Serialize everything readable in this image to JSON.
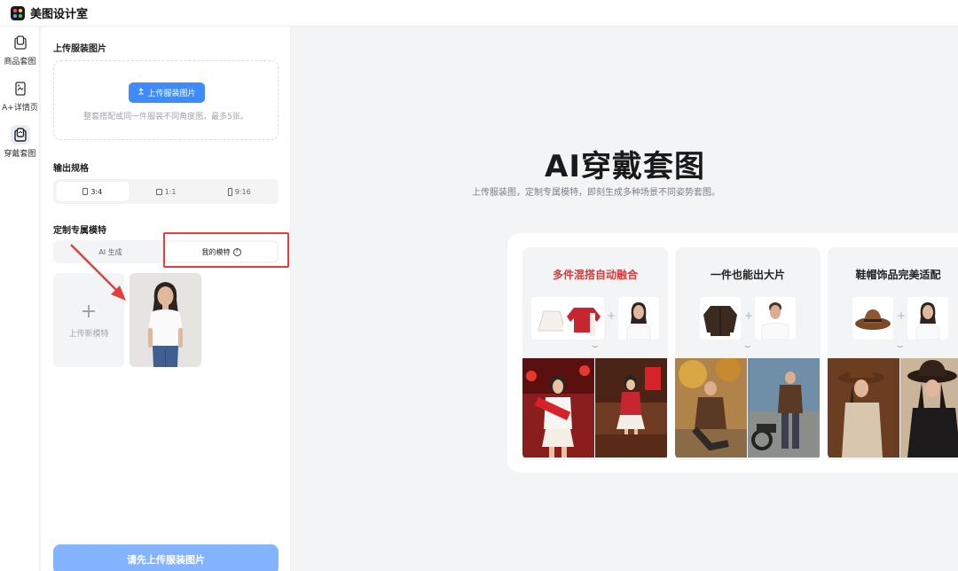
{
  "app": {
    "title": "美图设计室"
  },
  "rail": {
    "items": [
      {
        "label": "商品套图",
        "icon": "product-set-icon"
      },
      {
        "label": "A+详情页",
        "icon": "detail-page-icon"
      },
      {
        "label": "穿戴套图",
        "icon": "wear-set-icon",
        "active": true
      }
    ]
  },
  "panel": {
    "upload_title": "上传服装图片",
    "upload_button": "上传服装图片",
    "upload_hint": "整套搭配或同一件服装不同角度图，最多5张。",
    "output_title": "输出规格",
    "ratios": [
      {
        "label": "3:4",
        "active": true
      },
      {
        "label": "1:1",
        "active": false
      },
      {
        "label": "9:16",
        "active": false
      }
    ],
    "model_title": "定制专属模特",
    "model_tabs": [
      {
        "label": "AI 生成",
        "active": false
      },
      {
        "label": "我的模特",
        "active": true
      }
    ],
    "add_model_label": "上传新模特",
    "submit_button": "请先上传服装图片"
  },
  "main": {
    "title": "AI穿戴套图",
    "subtitle": "上传服装图，定制专属模特，即刻生成多种场景不同姿势套图。",
    "cards": [
      {
        "title": "多件混搭自动融合",
        "title_color": "#d93a3a"
      },
      {
        "title": "一件也能出大片",
        "title_color": "#222222"
      },
      {
        "title": "鞋帽饰品完美适配",
        "title_color": "#222222"
      }
    ]
  },
  "colors": {
    "accent": "#3d8bff",
    "accent_disabled": "#84b4ff",
    "annotation_red": "#e53e3e"
  }
}
